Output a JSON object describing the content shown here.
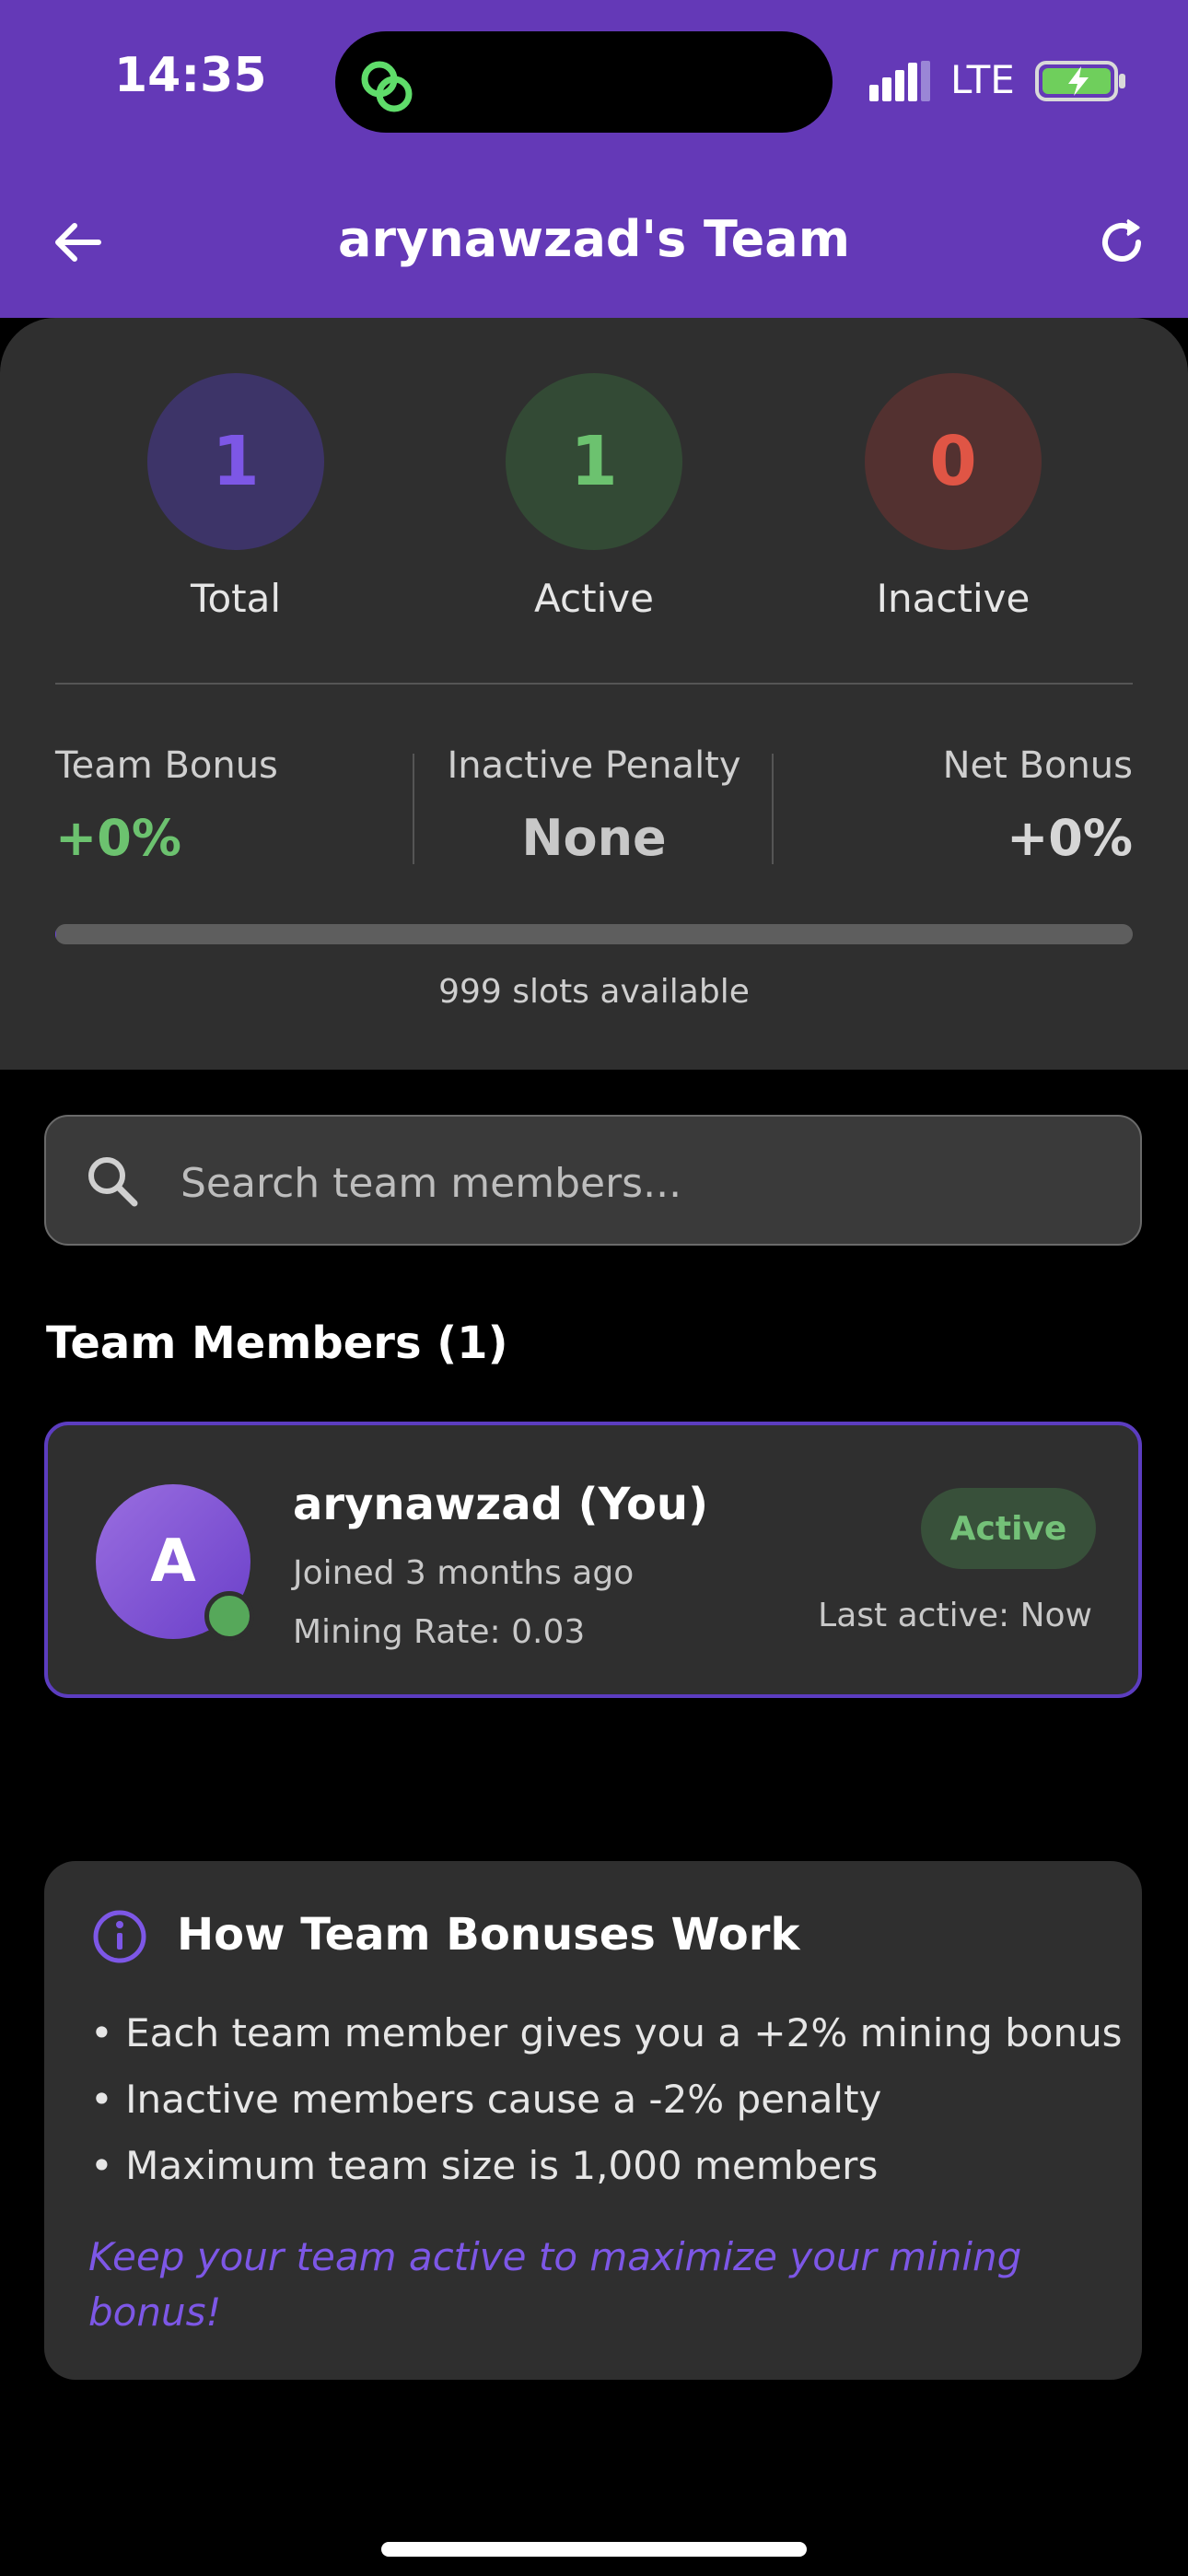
{
  "status_bar": {
    "time": "14:35",
    "network": "LTE"
  },
  "header": {
    "title": "arynawzad's Team",
    "back_icon": "arrow-left-icon",
    "refresh_icon": "refresh-icon"
  },
  "stats": {
    "total": {
      "value": "1",
      "label": "Total"
    },
    "active": {
      "value": "1",
      "label": "Active"
    },
    "inactive": {
      "value": "0",
      "label": "Inactive"
    }
  },
  "bonus": {
    "team_bonus": {
      "title": "Team Bonus",
      "value": "+0%"
    },
    "inactive_penalty": {
      "title": "Inactive Penalty",
      "value": "None"
    },
    "net_bonus": {
      "title": "Net Bonus",
      "value": "+0%"
    }
  },
  "capacity": {
    "progress_fraction": 0.001,
    "slots_text": "999 slots available"
  },
  "search": {
    "placeholder": "Search team members..."
  },
  "members_section": {
    "title": "Team Members (1)"
  },
  "members": [
    {
      "initial": "A",
      "name": "arynawzad (You)",
      "joined": "Joined 3 months ago",
      "mining_rate": "Mining Rate: 0.03",
      "status": "Active",
      "last_active": "Last active: Now"
    }
  ],
  "info": {
    "title": "How Team Bonuses Work",
    "bullets": [
      "• Each team member gives you a +2% mining bonus",
      "• Inactive members cause a -2% penalty",
      "• Maximum team size is 1,000 members"
    ],
    "footer": "Keep your team active to maximize your mining bonus!"
  },
  "colors": {
    "header_bg": "#6439b7",
    "accent_purple": "#7d57e6",
    "active_green": "#74c178",
    "inactive_red": "#e05545"
  }
}
